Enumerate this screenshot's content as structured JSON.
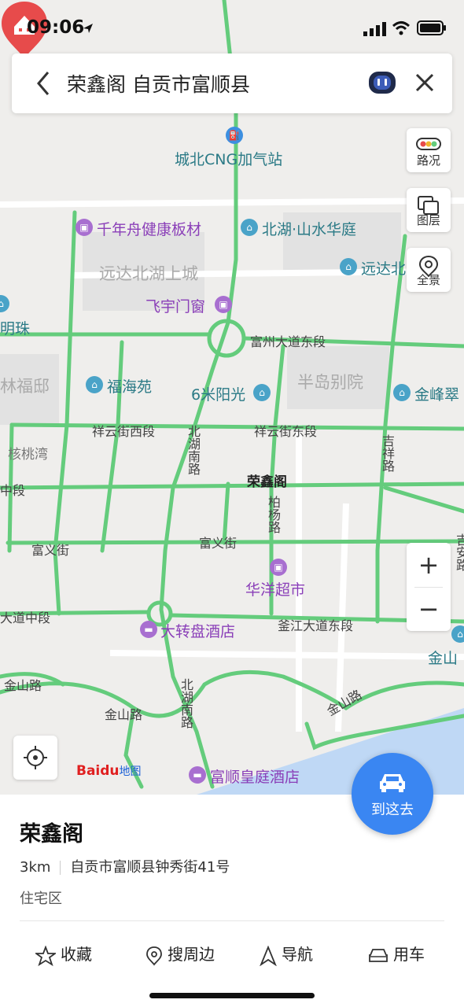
{
  "status_bar": {
    "time": "09:06"
  },
  "search": {
    "query": "荣鑫阁 自贡市富顺县"
  },
  "controls": {
    "traffic_label": "路况",
    "layers_label": "图层",
    "panorama_label": "全景",
    "zoom_in": "+",
    "zoom_out": "−"
  },
  "go_button": {
    "label": "到这去"
  },
  "brand": {
    "part1": "Bai",
    "part2": "du",
    "part3": "地图"
  },
  "map": {
    "pois": {
      "cng_station": "城北CNG加气站",
      "qianianzhou": "千年舟健康板材",
      "beihu_shanshui": "北湖·山水华庭",
      "yuanda_bei": "远达北",
      "feiyu": "飞宇门窗",
      "fuhaiyuan": "福海苑",
      "liumi": "6米阳光",
      "jinfeng": "金峰翠",
      "huayang": "华洋超市",
      "dazhuanpan": "大转盘酒店",
      "fushun_huangting": "富顺皇庭酒店",
      "jinshan": "金山",
      "mingzhu": "明珠",
      "target": "荣鑫阁"
    },
    "areas": {
      "yuanda_beihu": "远达北湖上城",
      "bandao": "半岛别院",
      "linfudi": "林福邸",
      "hetaowan": "核桃湾"
    },
    "roads": {
      "fuzhou_east": "富州大道东段",
      "xiangyun_west": "祥云街西段",
      "xiangyun_east": "祥云街东段",
      "beihu_south_1": "北湖南路",
      "beihu_south_2": "北湖南路",
      "boyang": "柏杨路",
      "jixiang": "吉祥路",
      "fuyi_1": "富义街",
      "fuyi_2": "富义街",
      "fuzhong": "中段",
      "dadao_zhong": "大道中段",
      "fujiang_east": "釜江大道东段",
      "jinshan_1": "金山路",
      "jinshan_2": "金山路",
      "jinshan_3": "金山路",
      "jian_right": "吉安路"
    }
  },
  "place": {
    "name": "荣鑫阁",
    "distance": "3km",
    "address": "自贡市富顺县钟秀街41号",
    "category": "住宅区"
  },
  "actions": {
    "favorite": "收藏",
    "nearby": "搜周边",
    "navigate": "导航",
    "car": "用车"
  },
  "colors": {
    "road_green": "#64cc7c",
    "accent_blue": "#3a86f2",
    "pin_red": "#e74b4b",
    "poi_teal": "#2b7a86",
    "poi_purple": "#8a3fb8",
    "water": "#bfd8f5"
  }
}
